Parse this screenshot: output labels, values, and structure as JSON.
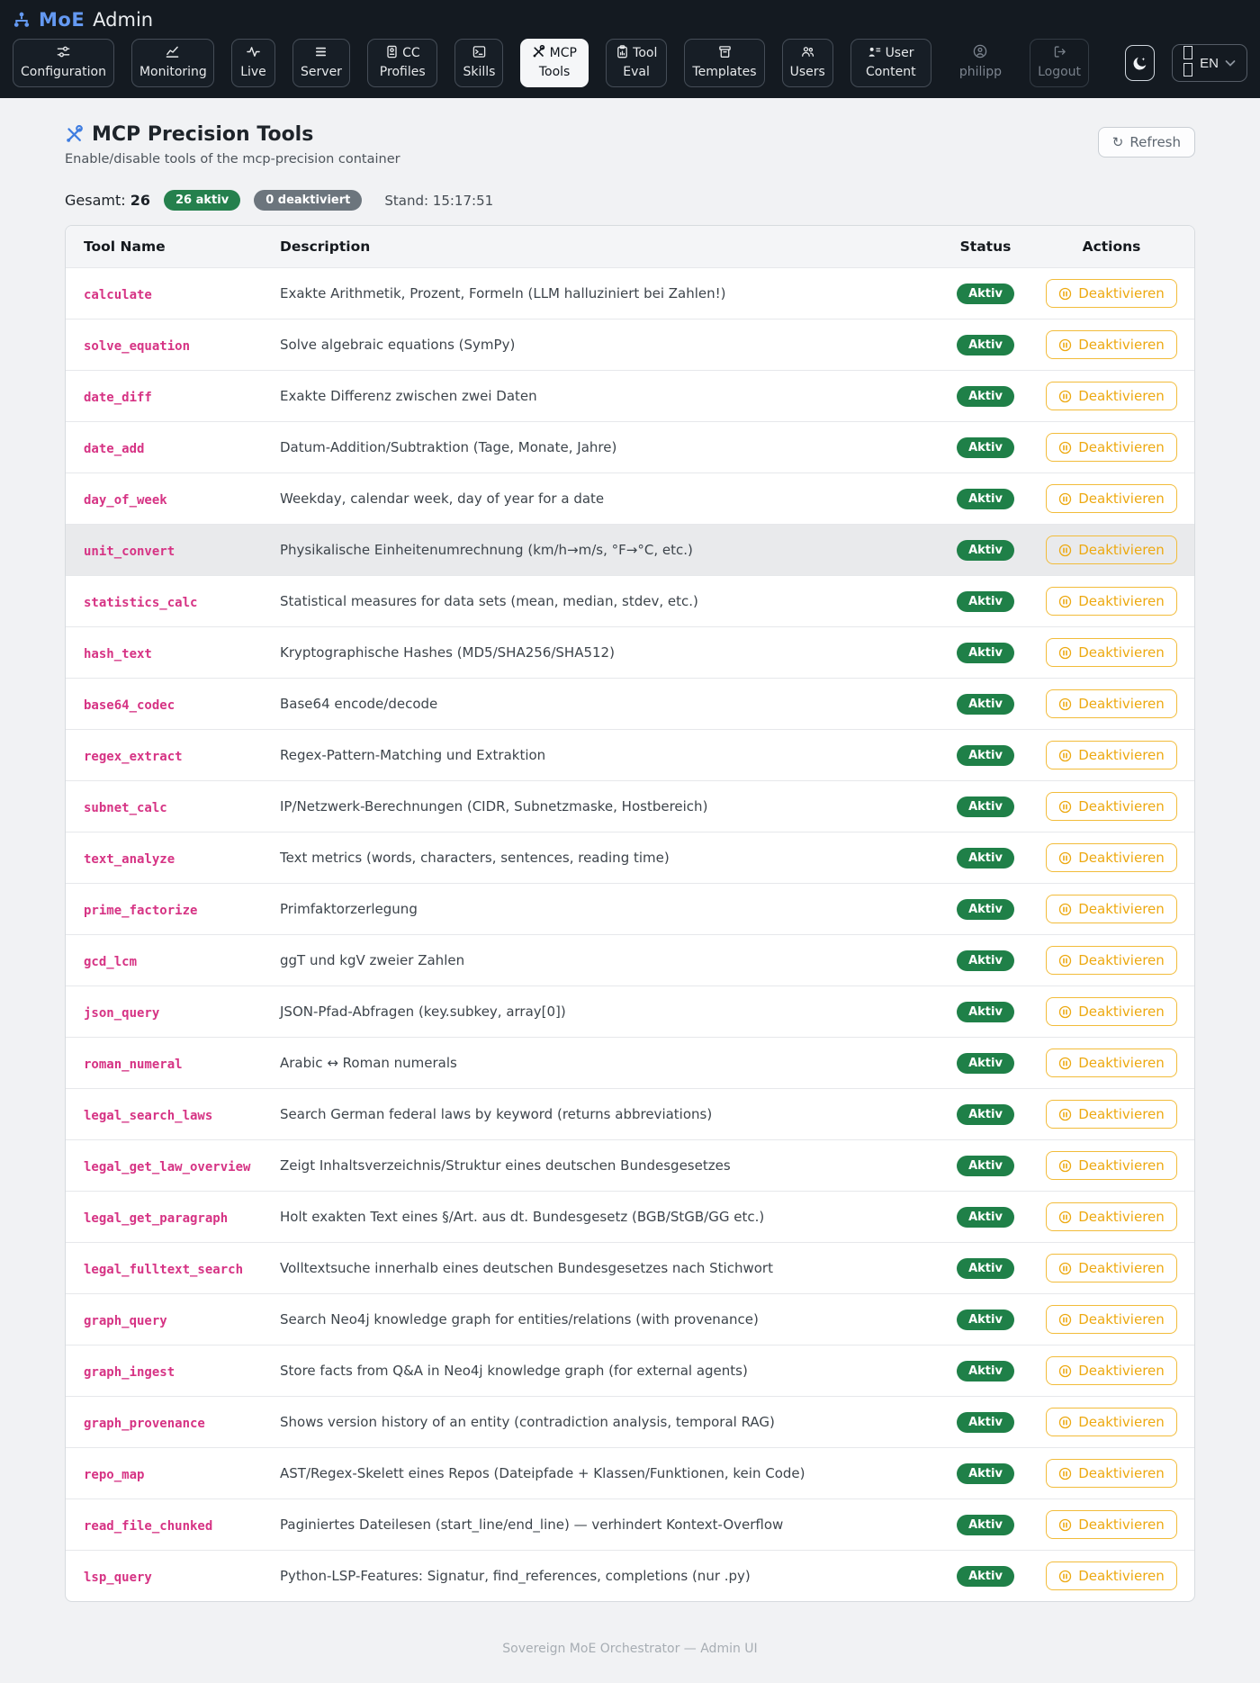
{
  "header": {
    "brand": {
      "name": "MoE",
      "suffix": "Admin"
    },
    "nav": [
      {
        "label": "Configuration",
        "icon": "sliders-icon",
        "active": false
      },
      {
        "label": "Monitoring",
        "icon": "line-chart-icon",
        "active": false
      },
      {
        "label": "Live",
        "icon": "activity-icon",
        "active": false
      },
      {
        "label": "Server",
        "icon": "server-icon",
        "active": false
      },
      {
        "label": "CC Profiles",
        "icon": "id-badge-icon",
        "active": false
      },
      {
        "label": "Skills",
        "icon": "terminal-icon",
        "active": false
      },
      {
        "label": "MCP Tools",
        "icon": "tools-icon",
        "active": true
      },
      {
        "label": "Tool Eval",
        "icon": "clipboard-chart-icon",
        "active": false
      },
      {
        "label": "Templates",
        "icon": "archive-icon",
        "active": false
      },
      {
        "label": "Users",
        "icon": "users-icon",
        "active": false
      },
      {
        "label": "User Content",
        "icon": "user-lines-icon",
        "active": false
      }
    ],
    "user": {
      "name": "philipp"
    },
    "logout_label": "Logout",
    "language": {
      "selected": "EN"
    }
  },
  "page": {
    "title": "MCP Precision Tools",
    "subtitle": "Enable/disable tools of the mcp-precision container",
    "refresh_label": "Refresh",
    "refresh_glyph": "↻",
    "stats": {
      "total_label": "Gesamt:",
      "total": "26",
      "active_badge": "26 aktiv",
      "inactive_badge": "0 deaktiviert",
      "stand": "Stand: 15:17:51"
    }
  },
  "table": {
    "columns": [
      "Tool Name",
      "Description",
      "Status",
      "Actions"
    ],
    "status_label": "Aktiv",
    "action_label": "Deaktivieren",
    "rows": [
      {
        "name": "calculate",
        "desc": "Exakte Arithmetik, Prozent, Formeln (LLM halluziniert bei Zahlen!)"
      },
      {
        "name": "solve_equation",
        "desc": "Solve algebraic equations (SymPy)"
      },
      {
        "name": "date_diff",
        "desc": "Exakte Differenz zwischen zwei Daten"
      },
      {
        "name": "date_add",
        "desc": "Datum-Addition/Subtraktion (Tage, Monate, Jahre)"
      },
      {
        "name": "day_of_week",
        "desc": "Weekday, calendar week, day of year for a date"
      },
      {
        "name": "unit_convert",
        "desc": "Physikalische Einheitenumrechnung (km/h→m/s, °F→°C, etc.)",
        "highlight": true
      },
      {
        "name": "statistics_calc",
        "desc": "Statistical measures for data sets (mean, median, stdev, etc.)"
      },
      {
        "name": "hash_text",
        "desc": "Kryptographische Hashes (MD5/SHA256/SHA512)"
      },
      {
        "name": "base64_codec",
        "desc": "Base64 encode/decode"
      },
      {
        "name": "regex_extract",
        "desc": "Regex-Pattern-Matching und Extraktion"
      },
      {
        "name": "subnet_calc",
        "desc": "IP/Netzwerk-Berechnungen (CIDR, Subnetzmaske, Hostbereich)"
      },
      {
        "name": "text_analyze",
        "desc": "Text metrics (words, characters, sentences, reading time)"
      },
      {
        "name": "prime_factorize",
        "desc": "Primfaktorzerlegung"
      },
      {
        "name": "gcd_lcm",
        "desc": "ggT und kgV zweier Zahlen"
      },
      {
        "name": "json_query",
        "desc": "JSON-Pfad-Abfragen (key.subkey, array[0])"
      },
      {
        "name": "roman_numeral",
        "desc": "Arabic ↔ Roman numerals"
      },
      {
        "name": "legal_search_laws",
        "desc": "Search German federal laws by keyword (returns abbreviations)"
      },
      {
        "name": "legal_get_law_overview",
        "desc": "Zeigt Inhaltsverzeichnis/Struktur eines deutschen Bundesgesetzes"
      },
      {
        "name": "legal_get_paragraph",
        "desc": "Holt exakten Text eines §/Art. aus dt. Bundesgesetz (BGB/StGB/GG etc.)"
      },
      {
        "name": "legal_fulltext_search",
        "desc": "Volltextsuche innerhalb eines deutschen Bundesgesetzes nach Stichwort"
      },
      {
        "name": "graph_query",
        "desc": "Search Neo4j knowledge graph for entities/relations (with provenance)"
      },
      {
        "name": "graph_ingest",
        "desc": "Store facts from Q&A in Neo4j knowledge graph (for external agents)"
      },
      {
        "name": "graph_provenance",
        "desc": "Shows version history of an entity (contradiction analysis, temporal RAG)"
      },
      {
        "name": "repo_map",
        "desc": "AST/Regex-Skelett eines Repos (Dateipfade + Klassen/Funktionen, kein Code)"
      },
      {
        "name": "read_file_chunked",
        "desc": "Paginiertes Dateilesen (start_line/end_line) — verhindert Kontext-Overflow"
      },
      {
        "name": "lsp_query",
        "desc": "Python-LSP-Features: Signatur, find_references, completions (nur .py)"
      }
    ]
  },
  "footer": {
    "text": "Sovereign MoE Orchestrator — Admin UI"
  },
  "colors": {
    "header_bg": "#141a21",
    "accent_blue": "#3f7de0",
    "brand_blue": "#6499f2",
    "tool_pink": "#d63384",
    "status_green": "#1f8048",
    "inactive_gray": "#6c757d",
    "action_amber": "#eda911"
  }
}
